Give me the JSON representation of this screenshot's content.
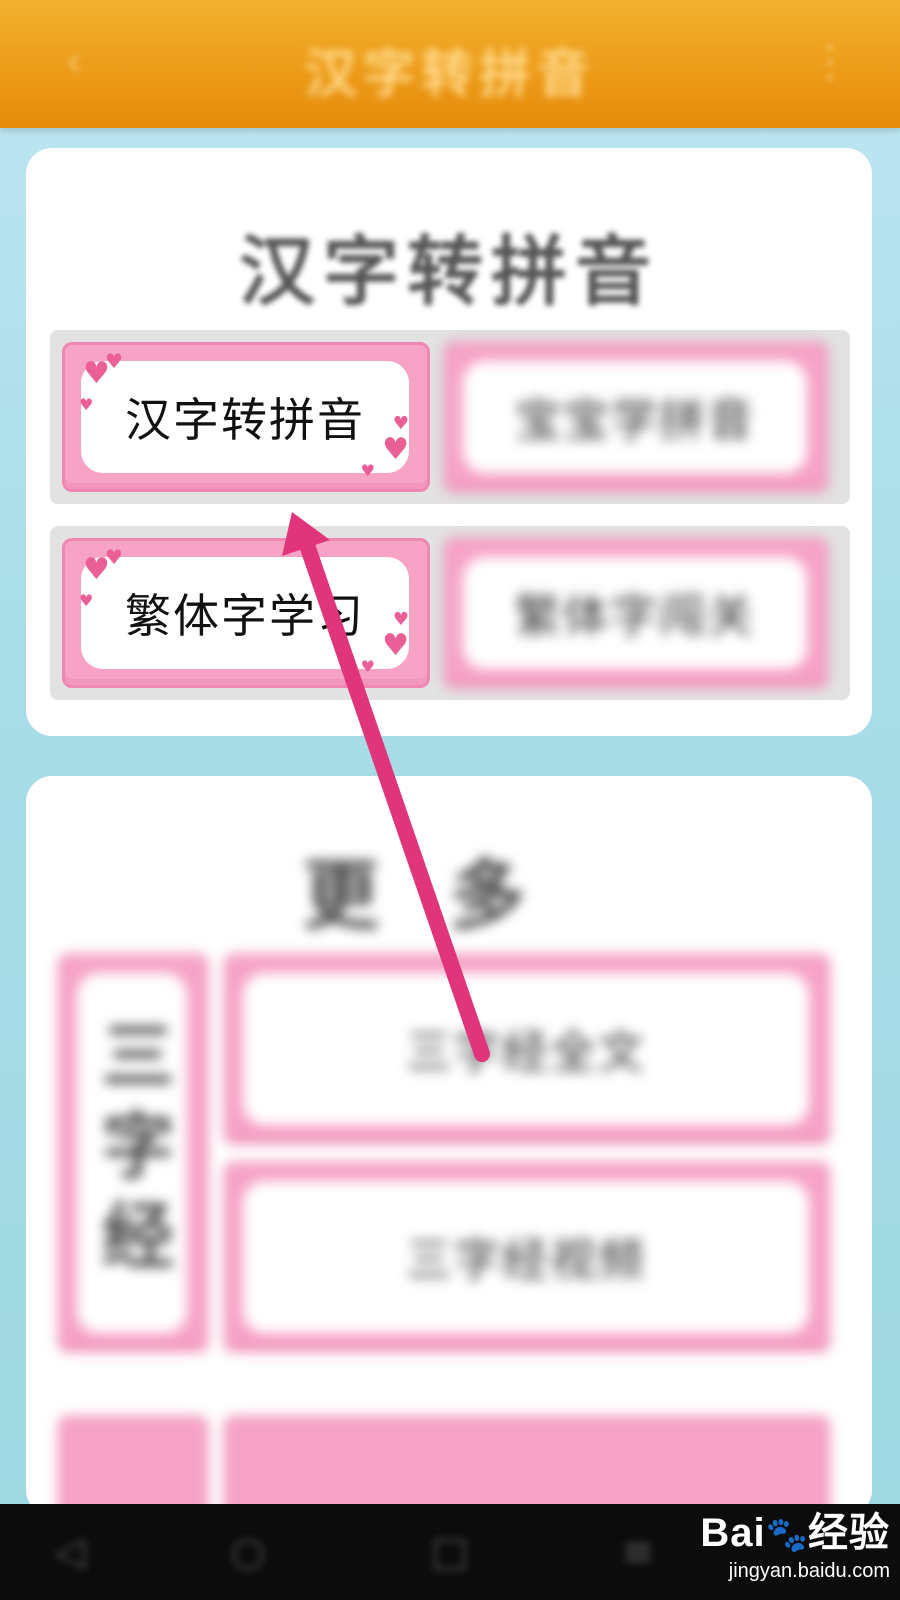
{
  "header": {
    "back_icon": "back-arrow-icon",
    "title": "汉字转拼音",
    "menu_icon": "more-vertical-icon"
  },
  "section1": {
    "title": "汉字转拼音",
    "tiles": [
      {
        "label": "汉字转拼音"
      },
      {
        "label": "宝宝学拼音"
      },
      {
        "label": "繁体字学习"
      },
      {
        "label": "繁体字闯关"
      }
    ]
  },
  "section2": {
    "title": "更多",
    "side_tile": "三字经",
    "tiles": [
      {
        "label": "三字经全文"
      },
      {
        "label": "三字经视频"
      }
    ]
  },
  "navbar": {
    "icons": [
      "back-nav-icon",
      "home-nav-icon",
      "recent-apps-icon",
      "menu-nav-icon"
    ]
  },
  "watermark": {
    "brand": "Bai",
    "brand_cn": "经验",
    "url": "jingyan.baidu.com"
  },
  "colors": {
    "header": "#ec9a17",
    "tile_border": "#f6a3c6",
    "arrow": "#e0357a"
  }
}
